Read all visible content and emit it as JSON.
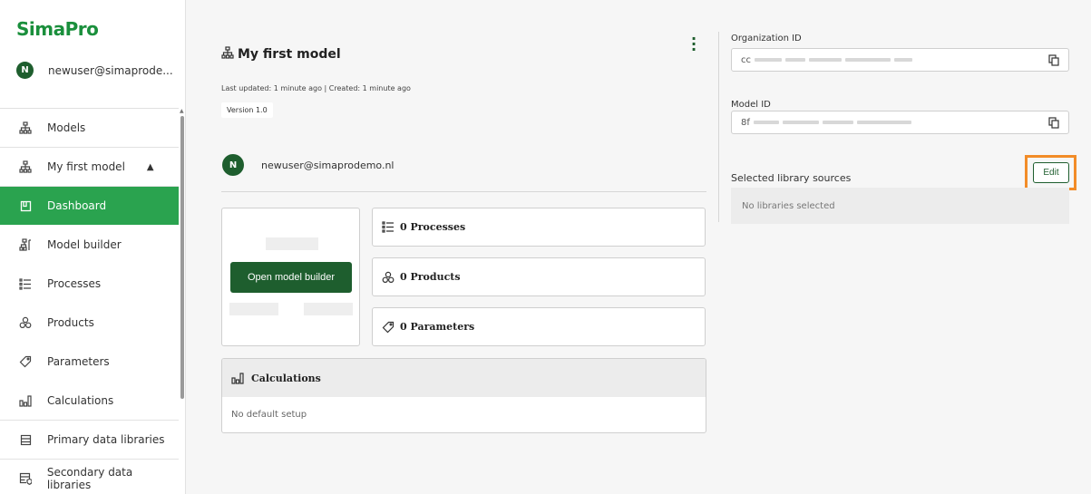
{
  "app": {
    "logo": "SimaPro"
  },
  "user": {
    "initial": "N",
    "email_short": "newuser@simaprode...",
    "email_full": "newuser@simaprodemo.nl"
  },
  "sidebar": {
    "items": [
      {
        "label": "Models",
        "icon": "hierarchy-icon"
      },
      {
        "label": "My first model",
        "icon": "hierarchy-icon"
      },
      {
        "label": "Dashboard",
        "icon": "dashboard-icon"
      },
      {
        "label": "Model builder",
        "icon": "model-builder-icon"
      },
      {
        "label": "Processes",
        "icon": "list-icon"
      },
      {
        "label": "Products",
        "icon": "boxes-icon"
      },
      {
        "label": "Parameters",
        "icon": "tag-icon"
      },
      {
        "label": "Calculations",
        "icon": "bar-chart-icon"
      },
      {
        "label": "Primary data libraries",
        "icon": "table-icon"
      },
      {
        "label": "Secondary data libraries",
        "icon": "table-shield-icon"
      }
    ]
  },
  "model": {
    "title": "My first model",
    "updated": "Last updated: 1 minute ago | Created: 1 minute ago",
    "version": "Version 1.0",
    "open_builder": "Open model builder",
    "processes": "0 Processes",
    "products": "0 Products",
    "parameters": "0 Parameters",
    "calculations": "Calculations",
    "no_default": "No default setup"
  },
  "right": {
    "org_label": "Organization ID",
    "org_prefix": "cc",
    "model_label": "Model ID",
    "model_prefix": "8f",
    "lib_label": "Selected library sources",
    "edit": "Edit",
    "no_libs": "No libraries selected"
  },
  "colors": {
    "brand_green": "#1a8f3c",
    "active_green": "#2aa34f",
    "dark_green": "#1e5e2e",
    "highlight_orange": "#f28c28"
  }
}
